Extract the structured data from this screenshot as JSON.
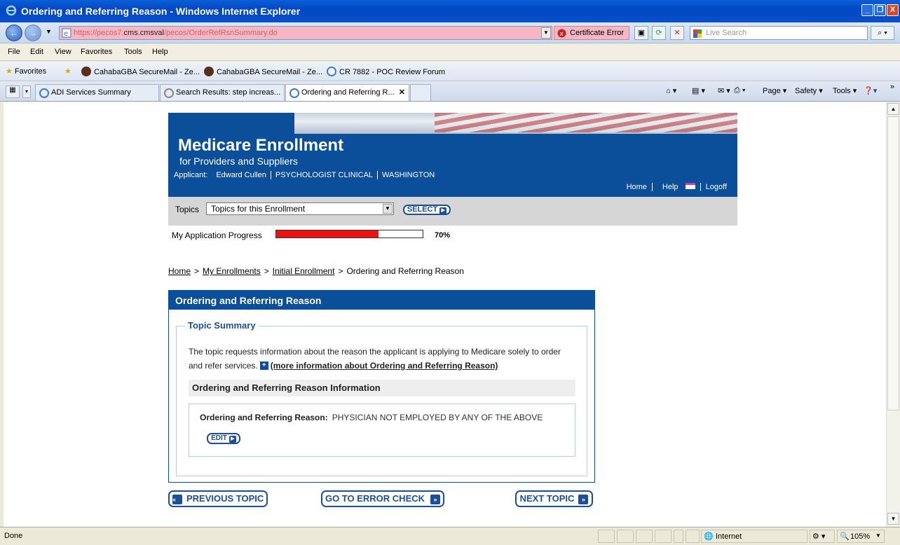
{
  "window": {
    "title": "Ordering and Referring Reason - Windows Internet Explorer",
    "min": "_",
    "max": "❐",
    "close": "X"
  },
  "address": {
    "prefix": "https://pecos7.",
    "host": "cms.cmsval",
    "path": "/pecos/OrderRefRsnSummary.do",
    "cert_error": "Certificate Error",
    "search_placeholder": "Live Search"
  },
  "menu": [
    "File",
    "Edit",
    "View",
    "Favorites",
    "Tools",
    "Help"
  ],
  "favorites": {
    "label": "Favorites",
    "items": [
      "CahabaGBA SecureMail - Ze...",
      "CahabaGBA SecureMail - Ze...",
      "CR 7882 - POC Review Forum"
    ]
  },
  "tabs": [
    "ADI Services Summary",
    "Search Results: step increas...",
    "Ordering and Referring R..."
  ],
  "commands": {
    "page": "Page",
    "safety": "Safety",
    "tools": "Tools"
  },
  "banner": {
    "title": "Medicare Enrollment",
    "subtitle": "for Providers and Suppliers",
    "applicant_label": "Applicant:",
    "applicant_name": "Edward Cullen",
    "specialty": "PSYCHOLOGIST CLINICAL",
    "state": "WASHINGTON",
    "links": {
      "home": "Home",
      "help": "Help",
      "logoff": "Logoff"
    }
  },
  "topics": {
    "label": "Topics",
    "selected": "Topics for this Enrollment",
    "select_button": "SELECT"
  },
  "progress": {
    "label": "My Application Progress",
    "value": 0.7,
    "text": "70%"
  },
  "breadcrumb": {
    "home": "Home",
    "enrollments": "My Enrollments",
    "initial": "Initial Enrollment",
    "current": "Ordering and Referring Reason"
  },
  "panel": {
    "title": "Ordering and Referring Reason",
    "legend": "Topic Summary",
    "description": "The topic requests information about the reason the applicant is applying to Medicare solely to order and refer services.",
    "more_info": "(more information about Ordering and Referring Reason)",
    "subheading": "Ordering and Referring Reason Information",
    "field_label": "Ordering and Referring Reason:",
    "field_value": "PHYSICIAN NOT EMPLOYED BY ANY OF THE ABOVE",
    "edit_button": "EDIT"
  },
  "nav": {
    "previous": "PREVIOUS TOPIC",
    "error_check": "GO TO ERROR CHECK",
    "next": "NEXT TOPIC"
  },
  "status": {
    "left": "Done",
    "zone": "Internet",
    "zoom": "105%"
  }
}
